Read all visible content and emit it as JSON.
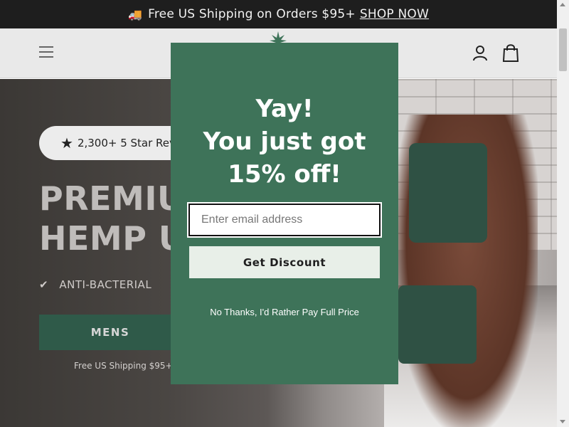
{
  "announcement": {
    "text": "Free US Shipping on Orders $95+",
    "link_label": "SHOP NOW",
    "icon": "truck-icon"
  },
  "header": {
    "menu_icon": "hamburger-menu-icon",
    "logo_icon": "hemp-leaf-icon",
    "account_icon": "user-icon",
    "cart_icon": "shopping-bag-icon"
  },
  "hero": {
    "reviews": "2,300+ 5 Star Rev",
    "title_line1": "PREMIU",
    "title_line2": "HEMP U",
    "feature": "ANTI-BACTERIAL",
    "button_label": "MENS",
    "shipping_note": "Free US Shipping $95+"
  },
  "modal": {
    "heading_line1": "Yay!",
    "heading_line2": "You just got",
    "heading_line3": "15% off!",
    "email_placeholder": "Enter email address",
    "button_label": "Get Discount",
    "decline_label": "No Thanks, I'd Rather Pay Full Price"
  },
  "colors": {
    "modal_bg": "#3e7359",
    "button_green": "#2f5a49",
    "announcement_bg": "#1e1e1e"
  }
}
